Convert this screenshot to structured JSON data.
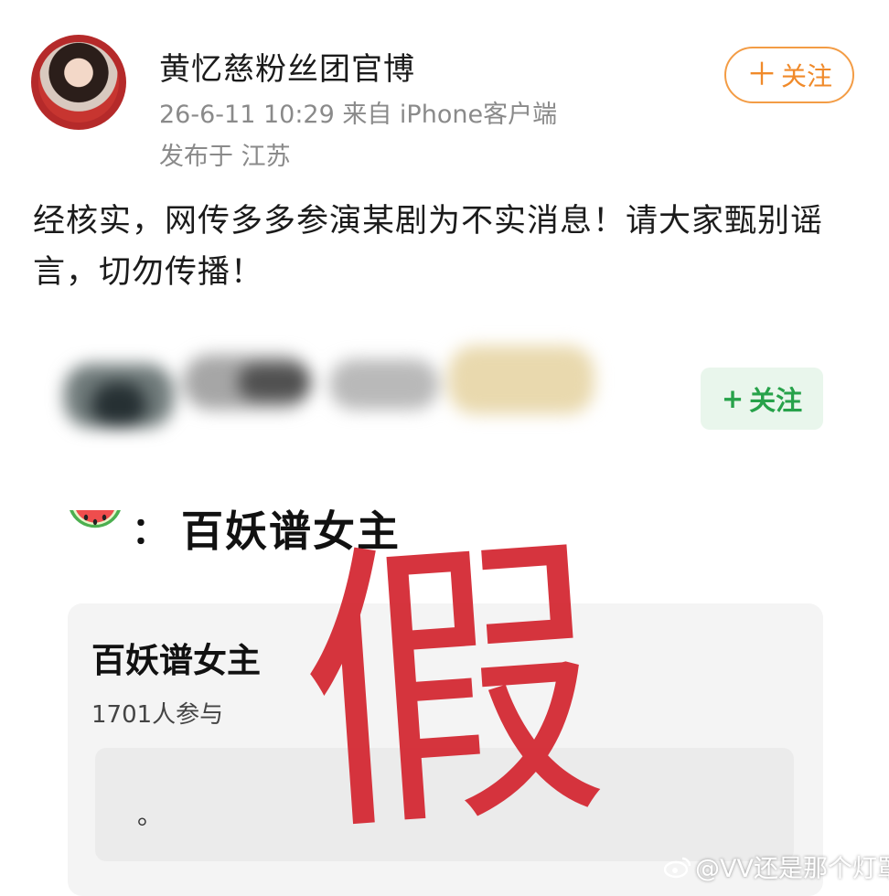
{
  "post": {
    "author": "黄忆慈粉丝团官博",
    "meta_line": "26-6-11 10:29  来自 iPhone客户端",
    "location_line": "发布于 江苏",
    "follow_label": "关注",
    "text": "经核实，网传多多参演某剧为不实消息！请大家甄别谣言，切勿传播！"
  },
  "embedded_screenshot": {
    "follow_label": "关注",
    "icon": "watermelon-icon",
    "colon": "：",
    "title": "百妖谱女主",
    "card": {
      "title": "百妖谱女主",
      "participants": "1701人参与",
      "content": "。"
    },
    "stamp": "假"
  },
  "watermark": {
    "icon": "weibo-icon",
    "text": "@VV还是那个灯罩"
  },
  "colors": {
    "follow_orange": "#f08a2a",
    "follow_green": "#27a24a",
    "stamp_red": "#d42a34"
  }
}
